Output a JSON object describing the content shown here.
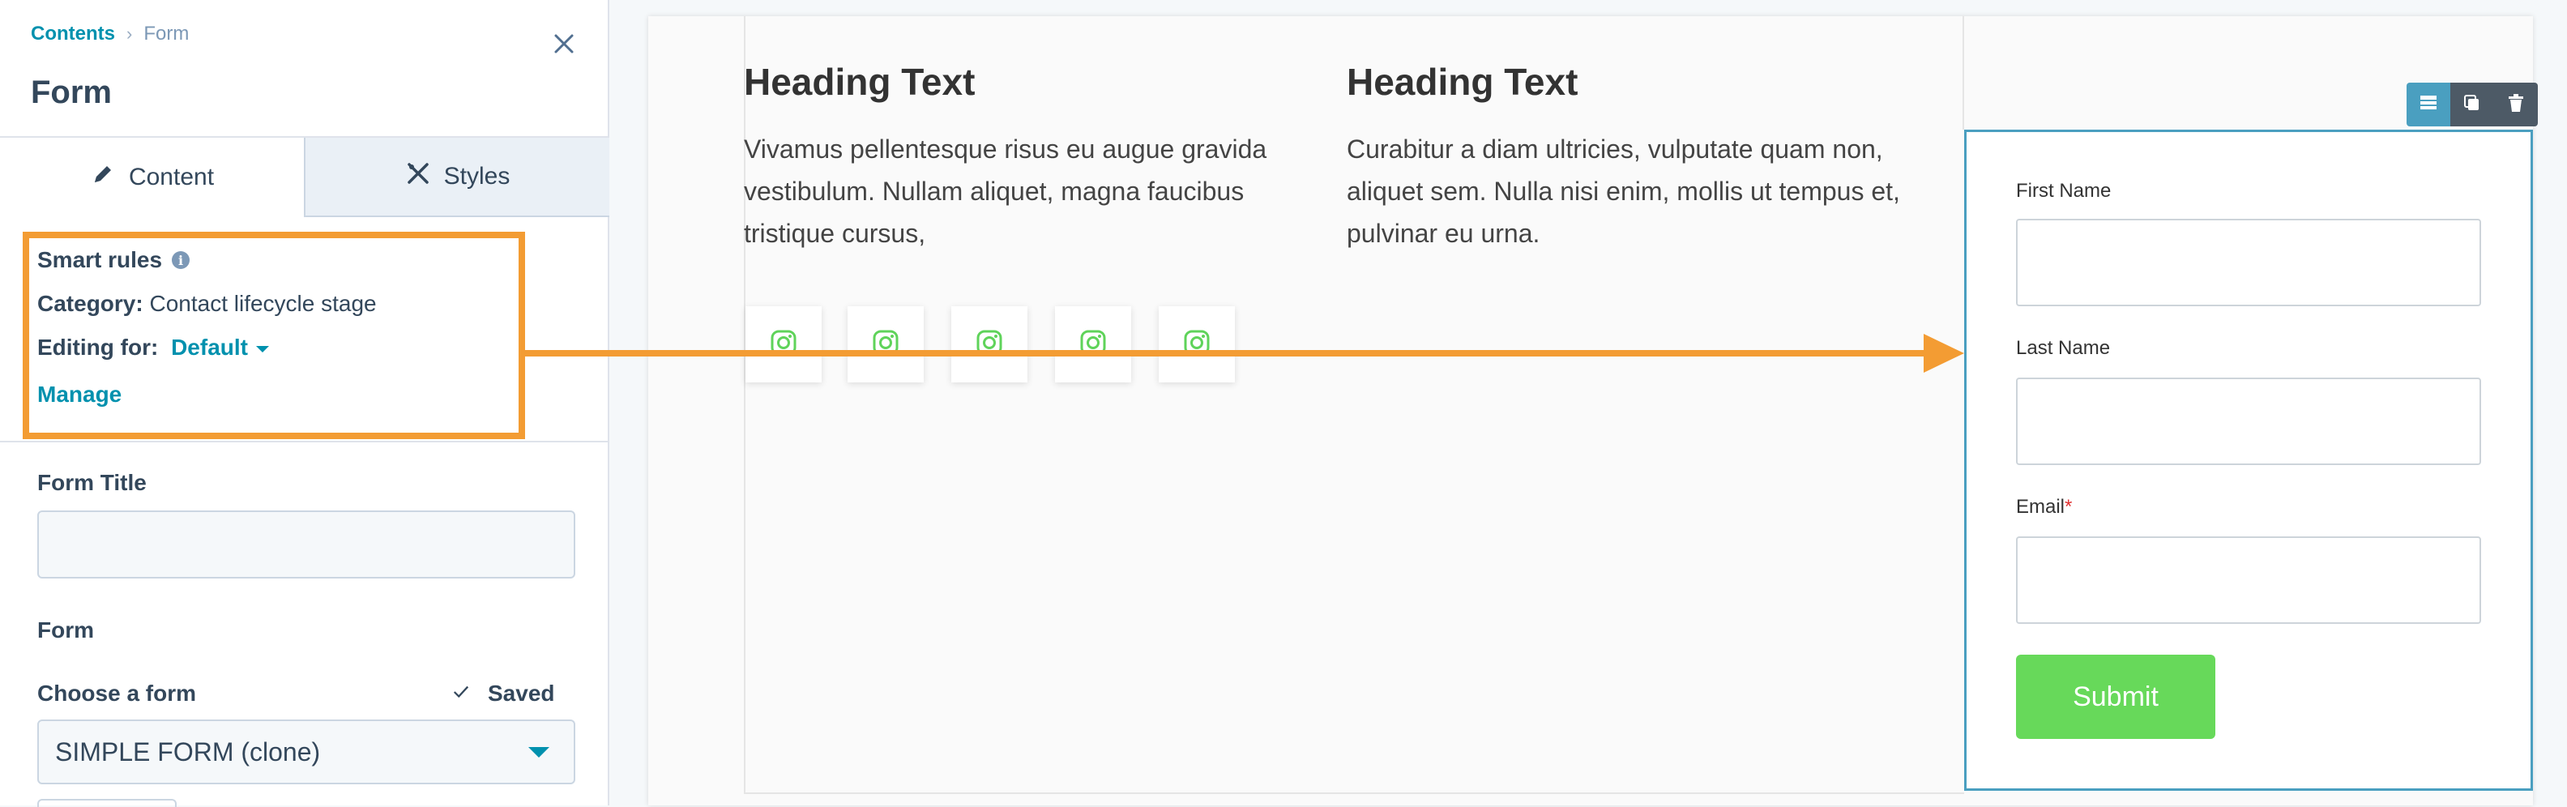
{
  "breadcrumb": {
    "parent": "Contents",
    "separator": "›",
    "current": "Form"
  },
  "panel": {
    "title": "Form"
  },
  "tabs": [
    {
      "label": "Content",
      "icon": "pencil-icon",
      "active": true
    },
    {
      "label": "Styles",
      "icon": "styles-icon",
      "active": false
    }
  ],
  "smart_rules": {
    "title": "Smart rules",
    "category_label": "Category:",
    "category_value": "Contact lifecycle stage",
    "editing_label": "Editing for:",
    "editing_value": "Default",
    "manage": "Manage"
  },
  "form_title": {
    "label": "Form Title",
    "value": ""
  },
  "form_section": {
    "heading": "Form",
    "choose_label": "Choose a form",
    "saved_label": "Saved",
    "selected_form": "SIMPLE FORM (clone)"
  },
  "canvas": {
    "columns": [
      {
        "heading": "Heading Text",
        "body": "Vivamus pellentesque risus eu augue gravida vestibulum. Nullam aliquet, magna faucibus tristique cursus,"
      },
      {
        "heading": "Heading Text",
        "body": "Curabitur a diam ultricies, vulputate quam non, aliquet sem. Nulla nisi enim, mollis ut tempus et, pulvinar eu urna."
      }
    ],
    "social_icons": [
      "instagram-icon",
      "instagram-icon",
      "instagram-icon",
      "instagram-icon",
      "instagram-icon"
    ],
    "form": {
      "fields": [
        {
          "label": "First Name",
          "required": false,
          "value": ""
        },
        {
          "label": "Last Name",
          "required": false,
          "value": ""
        },
        {
          "label": "Email",
          "required": true,
          "value": ""
        }
      ],
      "required_marker": "*",
      "submit_label": "Submit"
    },
    "toolbar_icons": [
      "module-settings-icon",
      "duplicate-icon",
      "trash-icon"
    ]
  },
  "colors": {
    "accent": "#0091ae",
    "highlight": "#f39c33",
    "submit": "#67d95a",
    "module_border": "#4a9fc0",
    "social_icon": "#5fd35a"
  }
}
